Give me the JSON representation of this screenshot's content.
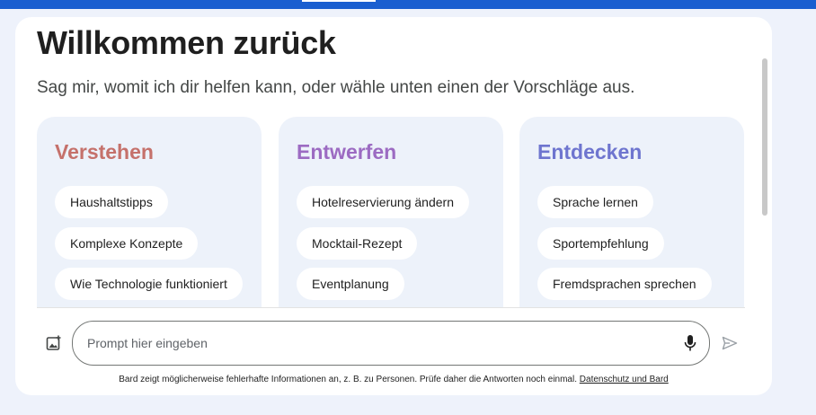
{
  "header": {
    "title": "Willkommen zurück",
    "subtitle": "Sag mir, womit ich dir helfen kann, oder wähle unten einen der Vorschläge aus."
  },
  "columns": [
    {
      "heading": "Verstehen",
      "color": "#c5716b",
      "chips": [
        "Haushaltstipps",
        "Komplexe Konzepte",
        "Wie Technologie funktioniert"
      ]
    },
    {
      "heading": "Entwerfen",
      "color": "#9c6bc2",
      "chips": [
        "Hotelreservierung ändern",
        "Mocktail-Rezept",
        "Eventplanung"
      ]
    },
    {
      "heading": "Entdecken",
      "color": "#6e75cf",
      "chips": [
        "Sprache lernen",
        "Sportempfehlung",
        "Fremdsprachen sprechen"
      ]
    }
  ],
  "prompt": {
    "placeholder": "Prompt hier eingeben",
    "value": ""
  },
  "icons": {
    "upload_image": "add-photo-icon",
    "microphone": "microphone-icon",
    "send": "send-icon"
  },
  "footer": {
    "disclaimer": "Bard zeigt möglicherweise fehlerhafte Informationen an, z. B. zu Personen. Prüfe daher die Antworten noch einmal.",
    "link_label": "Datenschutz und Bard"
  },
  "colors": {
    "accent_bar": "#1a5fd0",
    "card_bg": "#edf2fa"
  }
}
